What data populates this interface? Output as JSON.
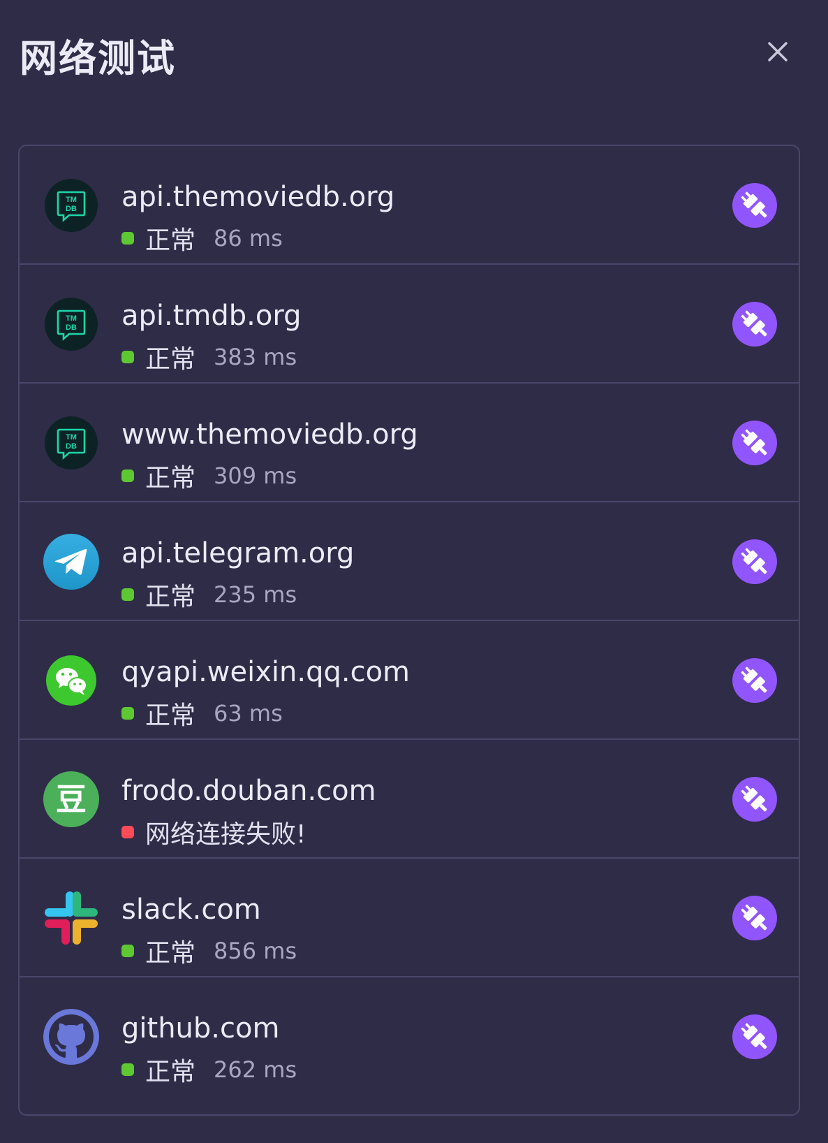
{
  "dialog": {
    "title": "网络测试"
  },
  "targets": [
    {
      "domain": "api.themoviedb.org",
      "status": "正常",
      "latency": "86 ms",
      "state": "ok",
      "icon": "tmdb-logo-icon"
    },
    {
      "domain": "api.tmdb.org",
      "status": "正常",
      "latency": "383 ms",
      "state": "ok",
      "icon": "tmdb-logo-icon"
    },
    {
      "domain": "www.themoviedb.org",
      "status": "正常",
      "latency": "309 ms",
      "state": "ok",
      "icon": "tmdb-logo-icon"
    },
    {
      "domain": "api.telegram.org",
      "status": "正常",
      "latency": "235 ms",
      "state": "ok",
      "icon": "telegram-logo-icon"
    },
    {
      "domain": "qyapi.weixin.qq.com",
      "status": "正常",
      "latency": "63 ms",
      "state": "ok",
      "icon": "wechat-logo-icon"
    },
    {
      "domain": "frodo.douban.com",
      "status": "网络连接失败!",
      "latency": "",
      "state": "fail",
      "icon": "douban-logo-icon"
    },
    {
      "domain": "slack.com",
      "status": "正常",
      "latency": "856 ms",
      "state": "ok",
      "icon": "slack-logo-icon"
    },
    {
      "domain": "github.com",
      "status": "正常",
      "latency": "262 ms",
      "state": "ok",
      "icon": "github-logo-icon"
    }
  ],
  "colors": {
    "background": "#2f2c48",
    "accent": "#9155fd",
    "ok": "#5ec832",
    "fail": "#ff4a57",
    "border": "#49466a"
  },
  "icons": {
    "close": "close-icon",
    "test": "plug-icon"
  },
  "logo_text": {
    "tmdb_line1": "TM",
    "tmdb_line2": "DB",
    "douban": "豆"
  }
}
